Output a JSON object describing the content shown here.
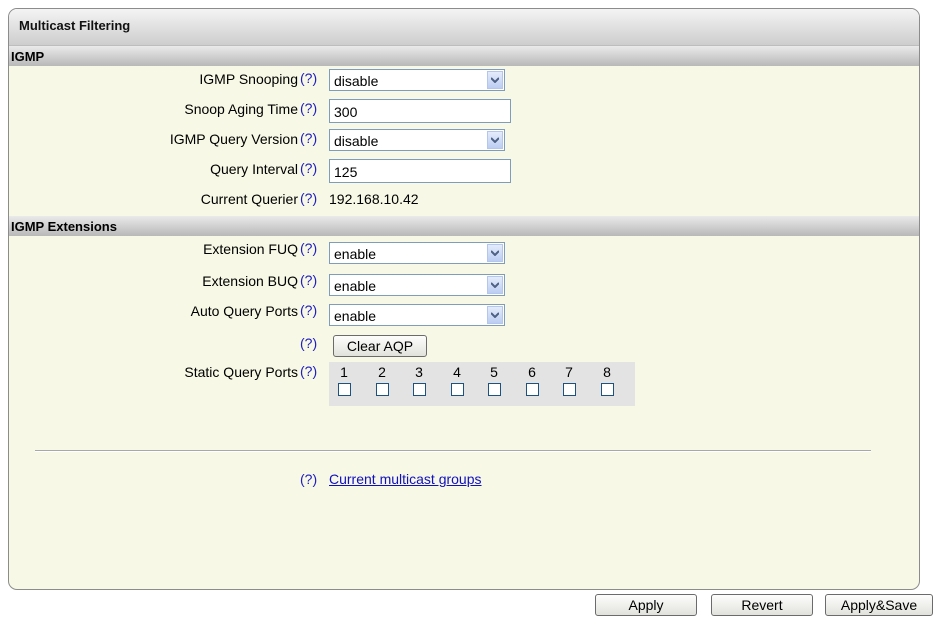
{
  "panel": {
    "title": "Multicast Filtering"
  },
  "igmp": {
    "section_title": "IGMP",
    "snooping": {
      "label": "IGMP Snooping",
      "value": "disable"
    },
    "aging": {
      "label": "Snoop Aging Time",
      "value": "300"
    },
    "query_version": {
      "label": "IGMP Query Version",
      "value": "disable"
    },
    "query_interval": {
      "label": "Query Interval",
      "value": "125"
    },
    "querier": {
      "label": "Current Querier",
      "value": "192.168.10.42"
    }
  },
  "ext": {
    "section_title": "IGMP Extensions",
    "fuq": {
      "label": "Extension FUQ",
      "value": "enable"
    },
    "buq": {
      "label": "Extension BUQ",
      "value": "enable"
    },
    "auto_query": {
      "label": "Auto Query Ports",
      "value": "enable"
    },
    "clear_aqp": "Clear AQP",
    "static_ports": {
      "label": "Static Query Ports",
      "ports": [
        "1",
        "2",
        "3",
        "4",
        "5",
        "6",
        "7",
        "8"
      ],
      "checked": [
        false,
        false,
        false,
        false,
        false,
        false,
        false,
        false
      ]
    }
  },
  "help_text": "(?)",
  "groups_link": "Current multicast groups",
  "buttons": {
    "apply": "Apply",
    "revert": "Revert",
    "apply_save": "Apply&Save"
  },
  "colors": {
    "panel_bg": "#f8f8e6",
    "help": "#2020c0",
    "link": "#1010c0"
  }
}
